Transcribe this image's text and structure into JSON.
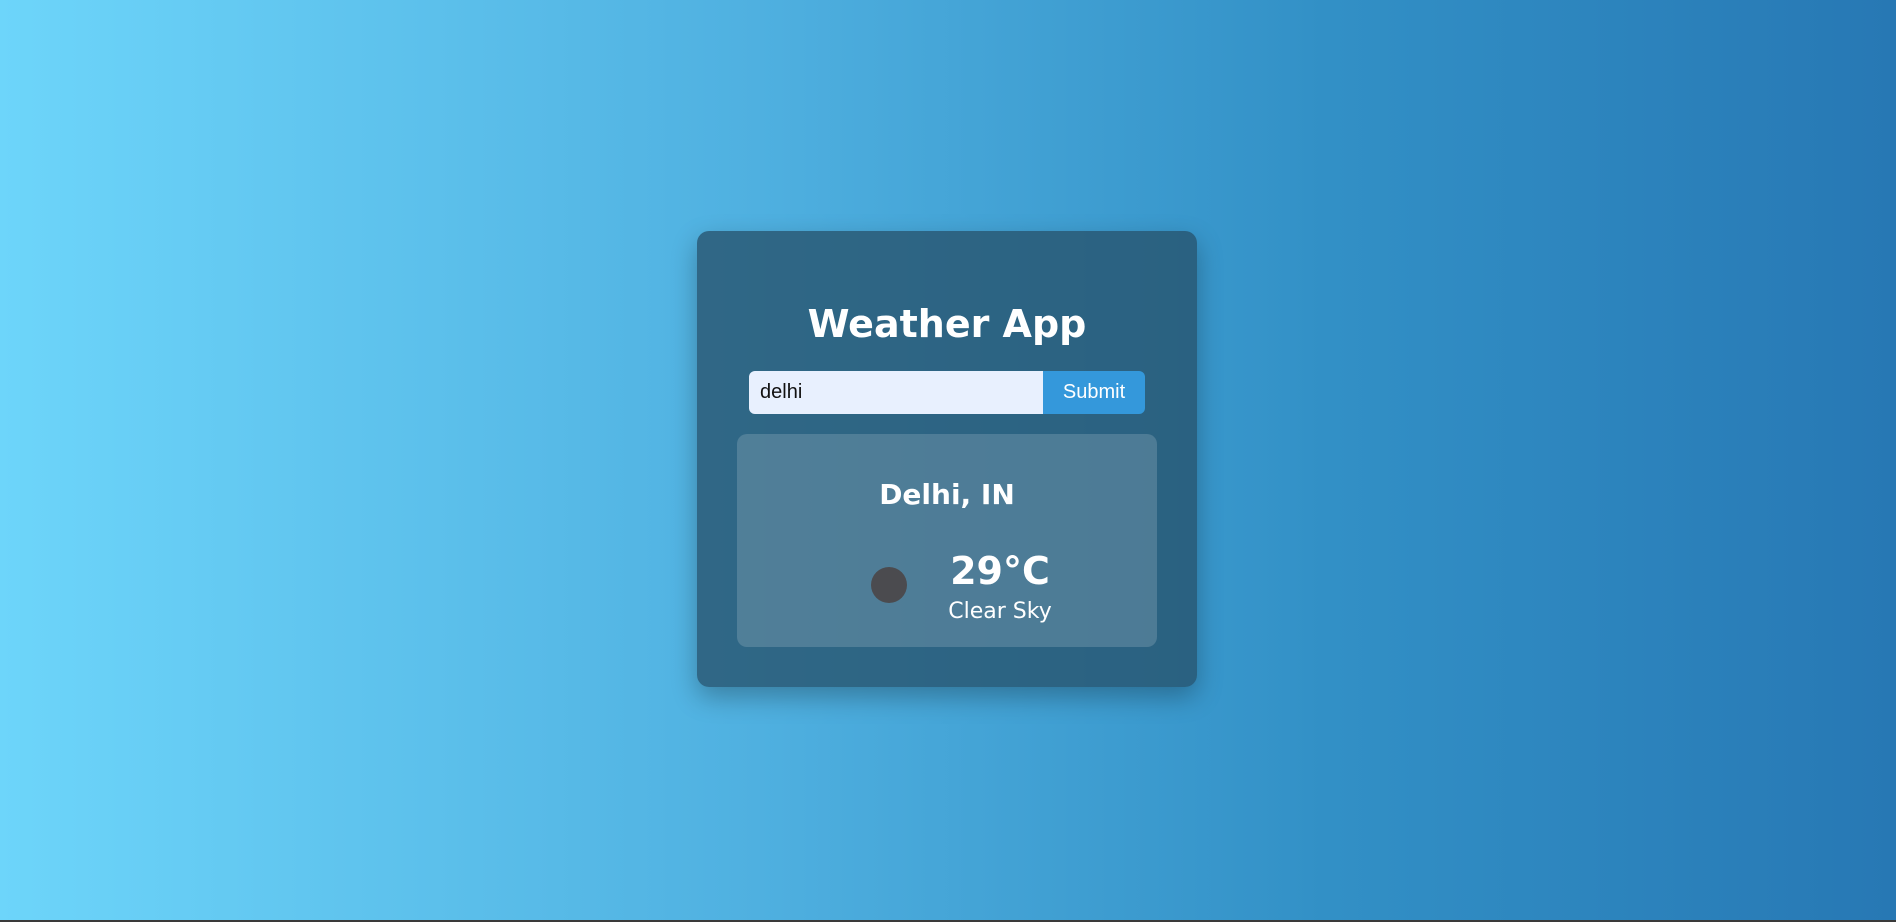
{
  "app": {
    "title": "Weather App"
  },
  "search": {
    "value": "delhi",
    "submit_label": "Submit"
  },
  "weather": {
    "location": "Delhi, IN",
    "temperature": "29°C",
    "condition": "Clear Sky",
    "icon": "clear-sky-icon"
  },
  "colors": {
    "background_start": "#6dd5fa",
    "background_end": "#2778b4",
    "button": "#3498db",
    "input_background": "#e8f0fe",
    "text": "#ffffff"
  }
}
